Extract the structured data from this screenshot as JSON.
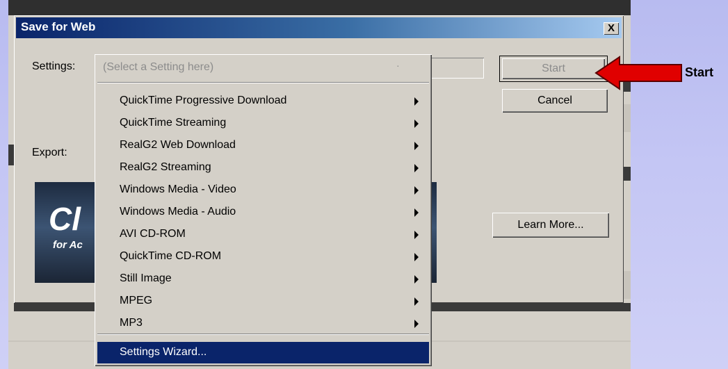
{
  "dialog": {
    "title": "Save for Web",
    "close_label": "X",
    "settings_label": "Settings:",
    "export_label": "Export:",
    "buttons": {
      "start": "Start",
      "cancel": "Cancel",
      "learn_more": "Learn More..."
    }
  },
  "settings_menu": {
    "placeholder": "(Select a Setting here)",
    "items": [
      {
        "label": "QuickTime Progressive Download",
        "submenu": true
      },
      {
        "label": "QuickTime Streaming",
        "submenu": true
      },
      {
        "label": "RealG2 Web Download",
        "submenu": true
      },
      {
        "label": "RealG2 Streaming",
        "submenu": true
      },
      {
        "label": "Windows Media - Video",
        "submenu": true
      },
      {
        "label": "Windows Media - Audio",
        "submenu": true
      },
      {
        "label": "AVI CD-ROM",
        "submenu": true
      },
      {
        "label": "QuickTime CD-ROM",
        "submenu": true
      },
      {
        "label": "Still Image",
        "submenu": true
      },
      {
        "label": "MPEG",
        "submenu": true
      },
      {
        "label": "MP3",
        "submenu": true
      }
    ],
    "wizard": "Settings Wizard..."
  },
  "banner": {
    "big_text": "Cl",
    "small_text": "for Ac"
  },
  "annotation": {
    "label": "Start",
    "arrow_color": "#e00000"
  }
}
